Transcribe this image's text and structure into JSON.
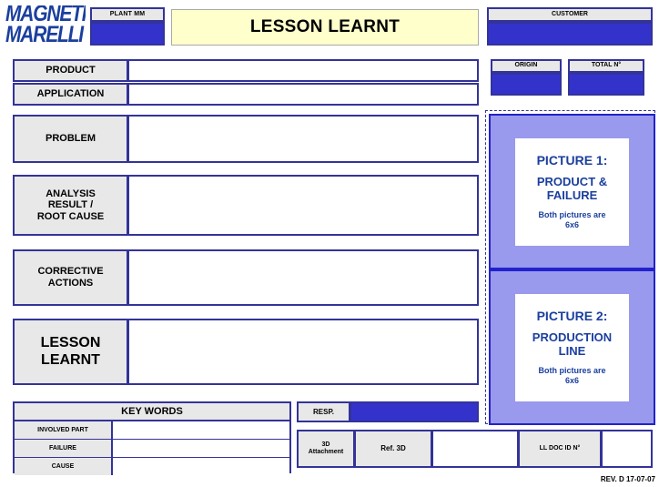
{
  "document": {
    "title": "LESSON LEARNT",
    "revision_footer": "REV. D 17-07-07"
  },
  "brand": {
    "logo_line1": "MAGNETI",
    "logo_line2": "MARELLI",
    "logo_color": "#1b3f9e"
  },
  "colors": {
    "border_blue": "#333399",
    "fill_blue": "#3333cc",
    "label_gray": "#e8e8e8",
    "title_cream": "#ffffcc",
    "picture_panel": "#9999ee",
    "picture_text": "#1b3f9e"
  },
  "header": {
    "plant_label": "PLANT MM",
    "plant_value": "",
    "customer_label": "CUSTOMER",
    "customer_value": "",
    "origin_label": "ORIGIN",
    "origin_value": "",
    "total_label": "TOTAL N°",
    "total_value": ""
  },
  "fields": {
    "product_label": "PRODUCT",
    "product_value": "",
    "application_label": "APPLICATION",
    "application_value": "",
    "problem_label": "PROBLEM",
    "problem_value": "",
    "analysis_label": "ANALYSIS RESULT / ROOT CAUSE",
    "analysis_label_lines": [
      "ANALYSIS",
      "RESULT /",
      "ROOT CAUSE"
    ],
    "analysis_value": "",
    "corrective_label_lines": [
      "CORRECTIVE",
      "ACTIONS"
    ],
    "corrective_value": "",
    "lesson_label_lines": [
      "LESSON",
      "LEARNT"
    ],
    "lesson_value": ""
  },
  "pictures": [
    {
      "heading": "PICTURE 1:",
      "subject": "PRODUCT & FAILURE",
      "subject_lines": [
        "PRODUCT &",
        "FAILURE"
      ],
      "note_lines": [
        "Both pictures are",
        "6x6"
      ]
    },
    {
      "heading": "PICTURE 2:",
      "subject": "PRODUCTION LINE",
      "subject_lines": [
        "PRODUCTION",
        "LINE"
      ],
      "note_lines": [
        "Both pictures are",
        "6x6"
      ]
    }
  ],
  "keywords": {
    "title": "KEY WORDS",
    "rows": [
      {
        "label": "INVOLVED PART",
        "value": ""
      },
      {
        "label": "FAILURE",
        "value": ""
      },
      {
        "label": "CAUSE",
        "value": ""
      }
    ]
  },
  "footer_fields": {
    "resp_label": "RESP.",
    "resp_value": "",
    "attachment_label_lines": [
      "3D",
      "Attachment"
    ],
    "ref3d_label": "Ref. 3D",
    "ref3d_value": "",
    "docid_label": "LL DOC ID N°",
    "docid_value": ""
  }
}
